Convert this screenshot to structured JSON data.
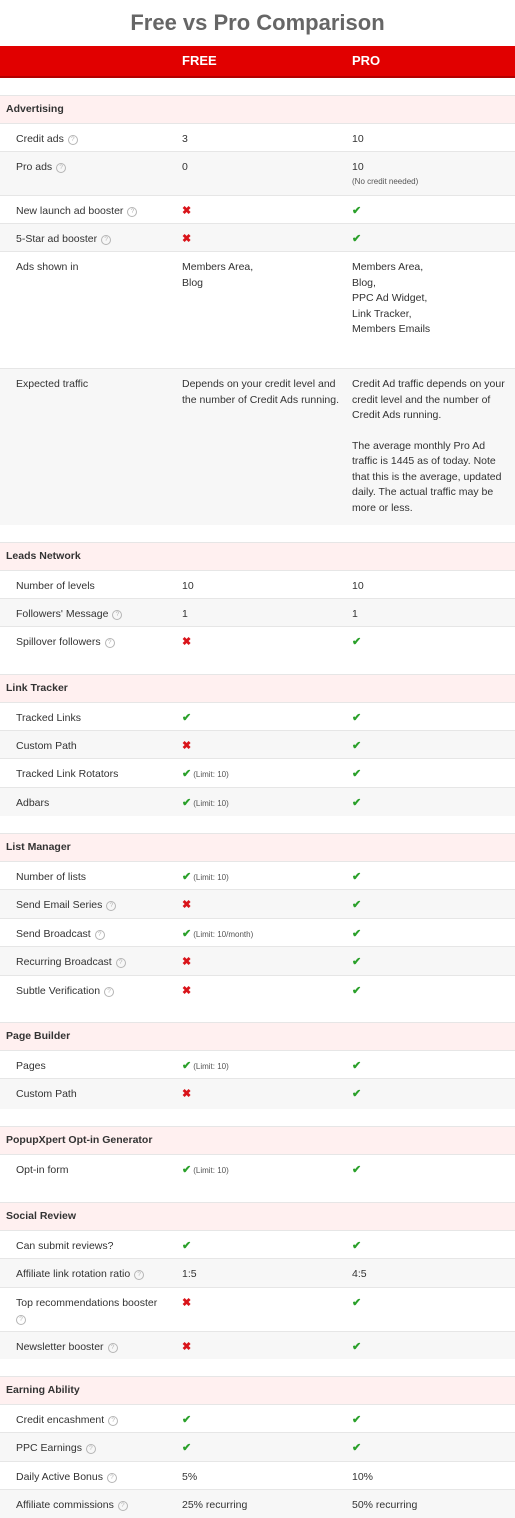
{
  "page": {
    "title": "Free vs Pro Comparison"
  },
  "header": {
    "free_label": "FREE",
    "pro_label": "PRO"
  },
  "colors": {
    "brand_red": "#e10000",
    "section_bg": "#fff0f0",
    "check": "#2aa02a",
    "cross": "#d9141a"
  },
  "icons": {
    "yes": "check-icon",
    "no": "cross-icon",
    "info": "help-icon"
  },
  "sections": [
    {
      "title": "Advertising",
      "rows": [
        {
          "label": "Credit ads",
          "help": true,
          "free": {
            "text": "3"
          },
          "pro": {
            "text": "10"
          }
        },
        {
          "label": "Pro ads",
          "help": true,
          "free": {
            "text": "0"
          },
          "pro": {
            "text": "10",
            "note": "(No credit needed)"
          }
        },
        {
          "label": "New launch ad booster",
          "help": true,
          "free": {
            "mark": "no"
          },
          "pro": {
            "mark": "yes"
          }
        },
        {
          "label": "5-Star ad booster",
          "help": true,
          "free": {
            "mark": "no"
          },
          "pro": {
            "mark": "yes"
          }
        },
        {
          "label": "Ads shown in",
          "free": {
            "lines": [
              "Members Area,",
              "Blog"
            ]
          },
          "pro": {
            "lines": [
              "Members Area,",
              "Blog,",
              "PPC Ad Widget,",
              "Link Tracker,",
              "Members Emails"
            ]
          }
        },
        {
          "label": "Expected traffic",
          "free": {
            "paras": [
              "Depends on your credit level and the number of Credit Ads running."
            ]
          },
          "pro": {
            "paras": [
              "Credit Ad traffic depends on your credit level and the number of Credit Ads running.",
              "The average monthly Pro Ad traffic is 1445 as of today. Note that this is the average, updated daily. The actual traffic may be more or less."
            ]
          }
        }
      ]
    },
    {
      "title": "Leads Network",
      "rows": [
        {
          "label": "Number of levels",
          "free": {
            "text": "10"
          },
          "pro": {
            "text": "10"
          }
        },
        {
          "label": "Followers' Message",
          "help": true,
          "free": {
            "text": "1"
          },
          "pro": {
            "text": "1"
          }
        },
        {
          "label": "Spillover followers",
          "help": true,
          "free": {
            "mark": "no"
          },
          "pro": {
            "mark": "yes"
          }
        }
      ]
    },
    {
      "title": "Link Tracker",
      "rows": [
        {
          "label": "Tracked Links",
          "free": {
            "mark": "yes"
          },
          "pro": {
            "mark": "yes"
          }
        },
        {
          "label": "Custom Path",
          "free": {
            "mark": "no"
          },
          "pro": {
            "mark": "yes"
          }
        },
        {
          "label": "Tracked Link Rotators",
          "free": {
            "mark": "yes",
            "limit": "(Limit: 10)"
          },
          "pro": {
            "mark": "yes"
          }
        },
        {
          "label": "Adbars",
          "free": {
            "mark": "yes",
            "limit": "(Limit: 10)"
          },
          "pro": {
            "mark": "yes"
          }
        }
      ]
    },
    {
      "title": "List Manager",
      "rows": [
        {
          "label": "Number of lists",
          "free": {
            "mark": "yes",
            "limit": "(Limit: 10)"
          },
          "pro": {
            "mark": "yes"
          }
        },
        {
          "label": "Send Email Series",
          "help": true,
          "free": {
            "mark": "no"
          },
          "pro": {
            "mark": "yes"
          }
        },
        {
          "label": "Send Broadcast",
          "help": true,
          "free": {
            "mark": "yes",
            "limit": "(Limit: 10/month)"
          },
          "pro": {
            "mark": "yes"
          }
        },
        {
          "label": "Recurring Broadcast",
          "help": true,
          "free": {
            "mark": "no"
          },
          "pro": {
            "mark": "yes"
          }
        },
        {
          "label": "Subtle Verification",
          "help": true,
          "free": {
            "mark": "no"
          },
          "pro": {
            "mark": "yes"
          }
        }
      ]
    },
    {
      "title": "Page Builder",
      "rows": [
        {
          "label": "Pages",
          "free": {
            "mark": "yes",
            "limit": "(Limit: 10)"
          },
          "pro": {
            "mark": "yes"
          }
        },
        {
          "label": "Custom Path",
          "free": {
            "mark": "no"
          },
          "pro": {
            "mark": "yes"
          }
        }
      ]
    },
    {
      "title": "PopupXpert Opt-in Generator",
      "rows": [
        {
          "label": "Opt-in form",
          "free": {
            "mark": "yes",
            "limit": "(Limit: 10)"
          },
          "pro": {
            "mark": "yes"
          }
        }
      ]
    },
    {
      "title": "Social Review",
      "rows": [
        {
          "label": "Can submit reviews?",
          "free": {
            "mark": "yes"
          },
          "pro": {
            "mark": "yes"
          }
        },
        {
          "label": "Affiliate link rotation ratio",
          "help": true,
          "free": {
            "text": "1:5"
          },
          "pro": {
            "text": "4:5"
          }
        },
        {
          "label": "Top recommendations booster",
          "help": true,
          "help_wrap": true,
          "free": {
            "mark": "no"
          },
          "pro": {
            "mark": "yes"
          }
        },
        {
          "label": "Newsletter booster",
          "help": true,
          "free": {
            "mark": "no"
          },
          "pro": {
            "mark": "yes"
          }
        }
      ]
    },
    {
      "title": "Earning Ability",
      "rows": [
        {
          "label": "Credit encashment",
          "help": true,
          "free": {
            "mark": "yes"
          },
          "pro": {
            "mark": "yes"
          }
        },
        {
          "label": "PPC Earnings",
          "help": true,
          "free": {
            "mark": "yes"
          },
          "pro": {
            "mark": "yes"
          }
        },
        {
          "label": "Daily Active Bonus",
          "help": true,
          "free": {
            "text": "5%"
          },
          "pro": {
            "text": "10%"
          }
        },
        {
          "label": "Affiliate commissions",
          "help": true,
          "free": {
            "text": "25% recurring"
          },
          "pro": {
            "text": "50% recurring"
          }
        }
      ]
    }
  ]
}
